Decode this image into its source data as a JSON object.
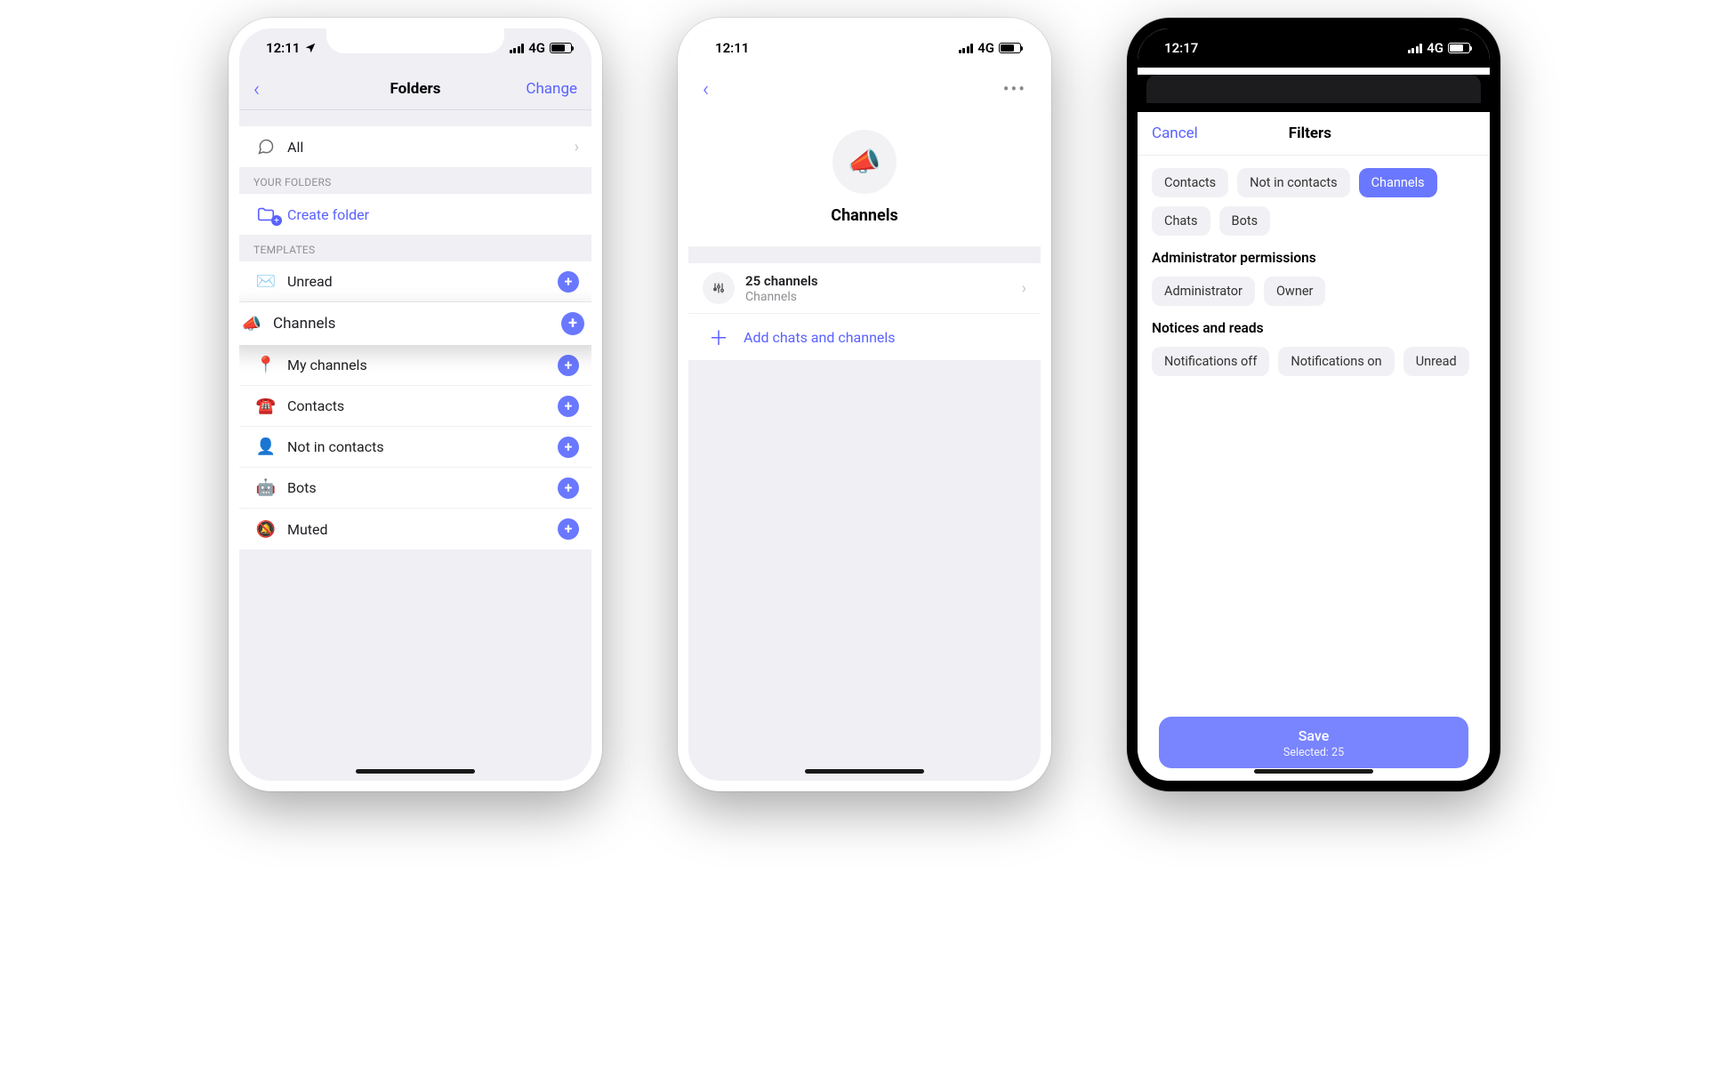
{
  "status": {
    "time_left": "12:11",
    "time_filters": "12:17",
    "network_label": "4G"
  },
  "phone1": {
    "title": "Folders",
    "change": "Change",
    "all": "All",
    "your_folders_header": "YOUR FOLDERS",
    "create_folder": "Create folder",
    "templates_header": "TEMPLATES",
    "templates": [
      {
        "label": "Unread",
        "icon": "✉️"
      },
      {
        "label": "Channels",
        "icon": "📣",
        "elevated": true
      },
      {
        "label": "My channels",
        "icon": "📍"
      },
      {
        "label": "Contacts",
        "icon": "☎️"
      },
      {
        "label": "Not in contacts",
        "icon": "👤"
      },
      {
        "label": "Bots",
        "icon": "🤖"
      },
      {
        "label": "Muted",
        "icon": "🔕"
      }
    ]
  },
  "phone2": {
    "title": "Channels",
    "count_title": "25 channels",
    "count_sub": "Channels",
    "add_label": "Add chats and channels"
  },
  "phone3": {
    "cancel": "Cancel",
    "title": "Filters",
    "main_chips": [
      {
        "label": "Contacts",
        "active": false
      },
      {
        "label": "Not in contacts",
        "active": false
      },
      {
        "label": "Channels",
        "active": true
      },
      {
        "label": "Chats",
        "active": false
      },
      {
        "label": "Bots",
        "active": false
      }
    ],
    "admin_header": "Administrator permissions",
    "admin_chips": [
      {
        "label": "Administrator"
      },
      {
        "label": "Owner"
      }
    ],
    "notices_header": "Notices and reads",
    "notices_chips": [
      {
        "label": "Notifications off"
      },
      {
        "label": "Notifications on"
      },
      {
        "label": "Unread"
      }
    ],
    "save_label": "Save",
    "save_sub": "Selected: 25"
  }
}
